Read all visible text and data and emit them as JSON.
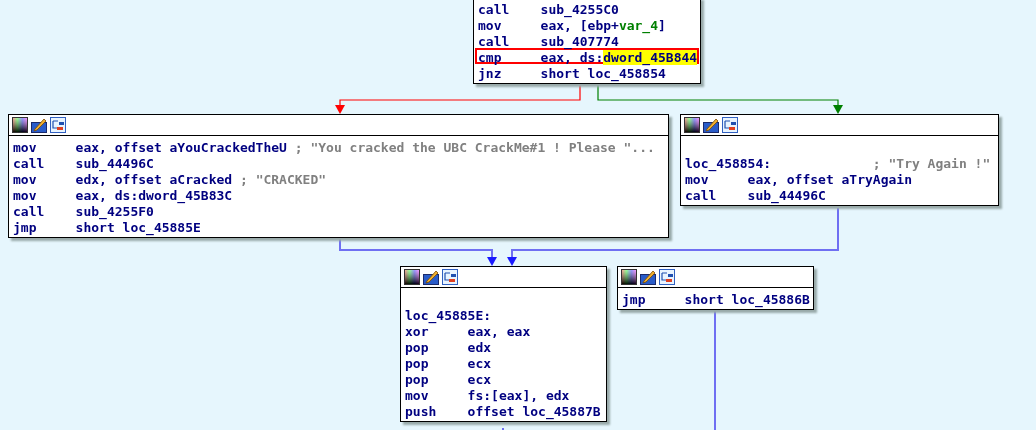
{
  "nodes": [
    {
      "toolbar": false,
      "lines": [
        {
          "kind": "instr",
          "mnemonic": "call",
          "selected": false,
          "operands": [
            {
              "kind": "text",
              "text": "sub_4255C0"
            }
          ]
        },
        {
          "kind": "instr",
          "mnemonic": "mov",
          "selected": false,
          "operands": [
            {
              "kind": "text",
              "text": "eax, [ebp+"
            },
            {
              "kind": "var",
              "text": "var_4"
            },
            {
              "kind": "text",
              "text": "]"
            }
          ]
        },
        {
          "kind": "instr",
          "mnemonic": "call",
          "selected": false,
          "operands": [
            {
              "kind": "text",
              "text": "sub_407774"
            }
          ]
        },
        {
          "kind": "instr",
          "mnemonic": "cmp",
          "selected": true,
          "operands": [
            {
              "kind": "text",
              "text": "eax, ds:"
            },
            {
              "kind": "highlight",
              "text": "dword_45B844"
            }
          ]
        },
        {
          "kind": "instr",
          "mnemonic": "jnz",
          "selected": false,
          "operands": [
            {
              "kind": "text",
              "text": "short loc_458854"
            }
          ]
        }
      ]
    },
    {
      "toolbar": true,
      "lines": [
        {
          "kind": "instr",
          "mnemonic": "mov",
          "selected": false,
          "operands": [
            {
              "kind": "text",
              "text": "eax, offset aYouCrackedTheU "
            },
            {
              "kind": "comment",
              "text": "; \"You cracked the UBC CrackMe#1 ! Please \"..."
            }
          ]
        },
        {
          "kind": "instr",
          "mnemonic": "call",
          "selected": false,
          "operands": [
            {
              "kind": "text",
              "text": "sub_44496C"
            }
          ]
        },
        {
          "kind": "instr",
          "mnemonic": "mov",
          "selected": false,
          "operands": [
            {
              "kind": "text",
              "text": "edx, offset aCracked "
            },
            {
              "kind": "comment",
              "text": "; \"CRACKED\""
            }
          ]
        },
        {
          "kind": "instr",
          "mnemonic": "mov",
          "selected": false,
          "operands": [
            {
              "kind": "text",
              "text": "eax, ds:dword_45B83C"
            }
          ]
        },
        {
          "kind": "instr",
          "mnemonic": "call",
          "selected": false,
          "operands": [
            {
              "kind": "text",
              "text": "sub_4255F0"
            }
          ]
        },
        {
          "kind": "instr",
          "mnemonic": "jmp",
          "selected": false,
          "operands": [
            {
              "kind": "text",
              "text": "short loc_45885E"
            }
          ]
        }
      ]
    },
    {
      "toolbar": true,
      "lines": [
        {
          "kind": "blank"
        },
        {
          "kind": "label",
          "label": "loc_458854:",
          "comment": "; \"Try Again !\"",
          "selected": false
        },
        {
          "kind": "instr",
          "mnemonic": "mov",
          "selected": false,
          "operands": [
            {
              "kind": "text",
              "text": "eax, offset aTryAgain"
            }
          ]
        },
        {
          "kind": "instr",
          "mnemonic": "call",
          "selected": false,
          "operands": [
            {
              "kind": "text",
              "text": "sub_44496C"
            }
          ]
        }
      ]
    },
    {
      "toolbar": true,
      "lines": [
        {
          "kind": "blank"
        },
        {
          "kind": "label",
          "label": "loc_45885E:",
          "selected": false
        },
        {
          "kind": "instr",
          "mnemonic": "xor",
          "selected": false,
          "operands": [
            {
              "kind": "text",
              "text": "eax, eax"
            }
          ]
        },
        {
          "kind": "instr",
          "mnemonic": "pop",
          "selected": false,
          "operands": [
            {
              "kind": "text",
              "text": "edx"
            }
          ]
        },
        {
          "kind": "instr",
          "mnemonic": "pop",
          "selected": false,
          "operands": [
            {
              "kind": "text",
              "text": "ecx"
            }
          ]
        },
        {
          "kind": "instr",
          "mnemonic": "pop",
          "selected": false,
          "operands": [
            {
              "kind": "text",
              "text": "ecx"
            }
          ]
        },
        {
          "kind": "instr",
          "mnemonic": "mov",
          "selected": false,
          "operands": [
            {
              "kind": "text",
              "text": "fs:[eax], edx"
            }
          ]
        },
        {
          "kind": "instr",
          "mnemonic": "push",
          "selected": false,
          "operands": [
            {
              "kind": "text",
              "text": "offset loc_45887B"
            }
          ]
        }
      ]
    },
    {
      "toolbar": true,
      "lines": [
        {
          "kind": "instr",
          "mnemonic": "jmp",
          "selected": false,
          "operands": [
            {
              "kind": "text",
              "text": "short loc_45886B"
            }
          ]
        }
      ]
    }
  ],
  "edges": [
    {
      "kind": "false"
    },
    {
      "kind": "true"
    },
    {
      "kind": "jump"
    },
    {
      "kind": "jump"
    },
    {
      "kind": "jump"
    },
    {
      "kind": "jump"
    }
  ]
}
